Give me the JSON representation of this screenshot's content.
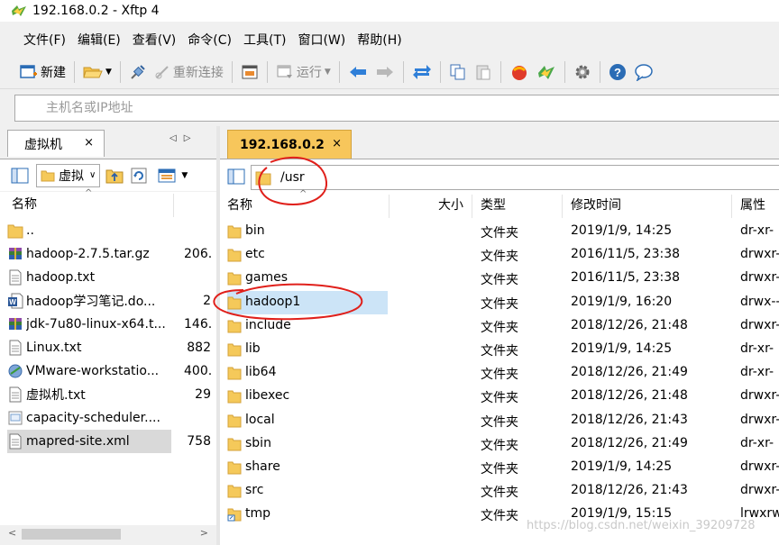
{
  "window": {
    "title": "192.168.0.2 - Xftp 4",
    "icon": "xftp-app-icon"
  },
  "menu": [
    "文件(F)",
    "编辑(E)",
    "查看(V)",
    "命令(C)",
    "工具(T)",
    "窗口(W)",
    "帮助(H)"
  ],
  "toolbar": {
    "new_label": "新建",
    "reconnect_label": "重新连接",
    "run_label": "运行"
  },
  "address": {
    "placeholder": "主机名或IP地址"
  },
  "left": {
    "tab_label": "虚拟机",
    "tab_close": "×",
    "path": "虚拟",
    "columns": {
      "name": "名称"
    },
    "files": [
      {
        "name": "..",
        "size": "",
        "icon": "folder"
      },
      {
        "name": "hadoop-2.7.5.tar.gz",
        "size": "206.",
        "icon": "archive"
      },
      {
        "name": "hadoop.txt",
        "size": "",
        "icon": "text"
      },
      {
        "name": "hadoop学习笔记.do...",
        "size": "2",
        "icon": "word"
      },
      {
        "name": "jdk-7u80-linux-x64.t...",
        "size": "146.",
        "icon": "archive"
      },
      {
        "name": "Linux.txt",
        "size": "882",
        "icon": "text"
      },
      {
        "name": "VMware-workstatio...",
        "size": "400.",
        "icon": "installer"
      },
      {
        "name": "虚拟机.txt",
        "size": "29",
        "icon": "text"
      },
      {
        "name": "capacity-scheduler....",
        "size": "",
        "icon": "xml"
      },
      {
        "name": "mapred-site.xml",
        "size": "758",
        "icon": "text"
      }
    ]
  },
  "right": {
    "tab_label": "192.168.0.2",
    "tab_close": "×",
    "path": "/usr",
    "columns": {
      "name": "名称",
      "size": "大小",
      "type": "类型",
      "mtime": "修改时间",
      "attr": "属性"
    },
    "files": [
      {
        "name": "bin",
        "type": "文件夹",
        "mtime": "2019/1/9, 14:25",
        "attr": "dr-xr-"
      },
      {
        "name": "etc",
        "type": "文件夹",
        "mtime": "2016/11/5, 23:38",
        "attr": "drwxr-"
      },
      {
        "name": "games",
        "type": "文件夹",
        "mtime": "2016/11/5, 23:38",
        "attr": "drwxr-"
      },
      {
        "name": "hadoop1",
        "type": "文件夹",
        "mtime": "2019/1/9, 16:20",
        "attr": "drwx--"
      },
      {
        "name": "include",
        "type": "文件夹",
        "mtime": "2018/12/26, 21:48",
        "attr": "drwxr-"
      },
      {
        "name": "lib",
        "type": "文件夹",
        "mtime": "2019/1/9, 14:25",
        "attr": "dr-xr-"
      },
      {
        "name": "lib64",
        "type": "文件夹",
        "mtime": "2018/12/26, 21:49",
        "attr": "dr-xr-"
      },
      {
        "name": "libexec",
        "type": "文件夹",
        "mtime": "2018/12/26, 21:48",
        "attr": "drwxr-"
      },
      {
        "name": "local",
        "type": "文件夹",
        "mtime": "2018/12/26, 21:43",
        "attr": "drwxr-"
      },
      {
        "name": "sbin",
        "type": "文件夹",
        "mtime": "2018/12/26, 21:49",
        "attr": "dr-xr-"
      },
      {
        "name": "share",
        "type": "文件夹",
        "mtime": "2019/1/9, 14:25",
        "attr": "drwxr-"
      },
      {
        "name": "src",
        "type": "文件夹",
        "mtime": "2018/12/26, 21:43",
        "attr": "drwxr-"
      },
      {
        "name": "tmp",
        "type": "文件夹",
        "mtime": "2019/1/9, 15:15",
        "attr": "lrwxrw"
      }
    ]
  },
  "watermark": "https://blog.csdn.net/weixin_39209728",
  "colors": {
    "active_tab": "#f7c65b",
    "selection": "#cce4f7",
    "annotation": "#e0201b"
  }
}
